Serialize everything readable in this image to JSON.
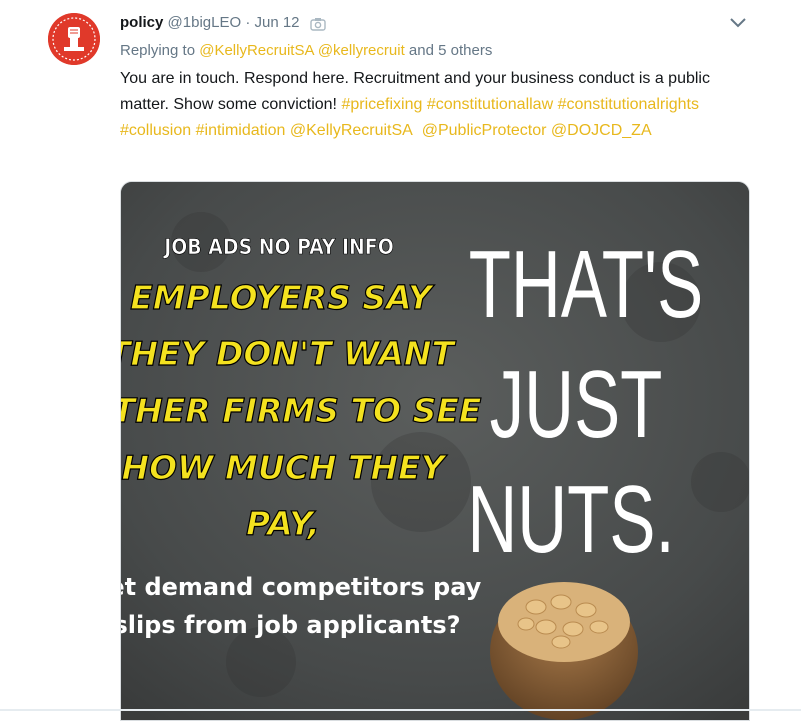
{
  "tweet": {
    "author_name": "policy",
    "handle": "@1bigLEO",
    "separator": "·",
    "date": "Jun 12",
    "replying_label": "Replying to",
    "reply_users": [
      "@KellyRecruitSA",
      "@kellyrecruit"
    ],
    "reply_and": "and",
    "reply_others": "5 others",
    "text_plain": "You are in touch. Respond here. Recruitment and your business conduct is a public matter. Show some conviction!",
    "hashtags": [
      "#pricefixing",
      "#constitutionallaw",
      "#constitutionalrights",
      "#collusion",
      "#intimidation"
    ],
    "mentions": [
      "@KellyRecruitSA",
      "@PublicProtector",
      "@DOJCD_ZA"
    ]
  },
  "icons": {
    "avatar": "raised-fist-logo",
    "camera": "camera-icon",
    "chevron": "chevron-down-icon"
  },
  "colors": {
    "link": "#e8b81d",
    "muted": "#657786",
    "text": "#14171a",
    "poster_yellow": "#f4e21f",
    "poster_bg": "#4a4d4d"
  },
  "poster": {
    "heading": "JOB ADS NO PAY INFO",
    "yellow_lines": [
      "EMPLOYERS SAY",
      "THEY DON'T WANT",
      "OTHER FIRMS TO SEE",
      "HOW MUCH THEY",
      "PAY,"
    ],
    "white_lines": [
      "yet demand competitors pay",
      "slips from job applicants?"
    ],
    "big_lines": [
      "THAT'S",
      "JUST",
      "NUTS."
    ]
  }
}
